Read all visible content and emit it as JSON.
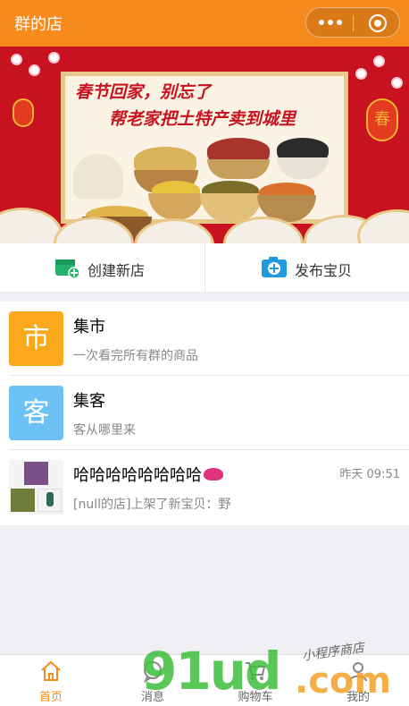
{
  "header": {
    "title": "群的店"
  },
  "banner": {
    "line1": "春节回家，别忘了",
    "line2": "帮老家把土特产卖到城里",
    "lantern_char": "春",
    "dots_active_index": 1
  },
  "actions": [
    {
      "label": "创建新店",
      "icon": "store-add-icon"
    },
    {
      "label": "发布宝贝",
      "icon": "camera-add-icon"
    }
  ],
  "list": [
    {
      "tile_char": "市",
      "tile_color": "#f9a91b",
      "name": "集市",
      "sub": "一次看完所有群的商品"
    },
    {
      "tile_char": "客",
      "tile_color": "#6cc1f5",
      "name": "集客",
      "sub": "客从哪里来"
    },
    {
      "name": "哈哈哈哈哈哈哈哈",
      "time": "昨天 09:51",
      "sub": "[null的店]上架了新宝贝：野"
    }
  ],
  "tabbar": [
    {
      "label": "首页",
      "icon": "home-icon",
      "active": true
    },
    {
      "label": "消息",
      "icon": "message-icon",
      "active": false
    },
    {
      "label": "购物车",
      "icon": "cart-icon",
      "active": false
    },
    {
      "label": "我的",
      "icon": "user-icon",
      "active": false
    }
  ],
  "watermark": {
    "brand": "91ud",
    "domain": ".com",
    "tag": "小程序商店"
  },
  "colors": {
    "accent": "#f78a1c",
    "banner_red": "#c8121f"
  }
}
